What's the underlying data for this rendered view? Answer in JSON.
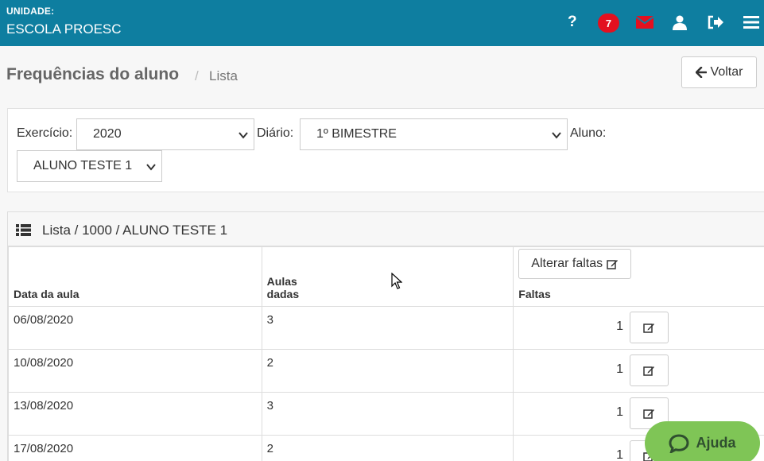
{
  "header": {
    "unit_label": "UNIDADE:",
    "unit_name": "ESCOLA PROESC",
    "notification_count": "7",
    "help_glyph": "?"
  },
  "page": {
    "title": "Frequências do aluno",
    "separator": "/",
    "breadcrumb": "Lista",
    "back_label": "Voltar"
  },
  "filters": {
    "exercicio_label": "Exercício:",
    "exercicio_value": "2020",
    "diario_label": "Diário:",
    "diario_value": "1º BIMESTRE",
    "aluno_label": "Aluno:",
    "aluno_value": "ALUNO TESTE 1"
  },
  "list": {
    "title": "Lista / 1000 / ALUNO TESTE 1",
    "columns": {
      "data": "Data da aula",
      "aulas_line1": "Aulas",
      "aulas_line2": "dadas",
      "faltas": "Faltas",
      "alter_label": "Alterar faltas"
    },
    "rows": [
      {
        "date": "06/08/2020",
        "aulas": "3",
        "faltas": "1"
      },
      {
        "date": "10/08/2020",
        "aulas": "2",
        "faltas": "1"
      },
      {
        "date": "13/08/2020",
        "aulas": "3",
        "faltas": "1"
      },
      {
        "date": "17/08/2020",
        "aulas": "2",
        "faltas": "1"
      }
    ]
  },
  "help_button": {
    "label": "Ajuda"
  },
  "colors": {
    "header_bg": "#0e7ea0",
    "badge_bg": "#e3101f",
    "help_bg": "#7fc556"
  },
  "icons": [
    "help-icon",
    "envelope-icon",
    "user-icon",
    "logout-icon",
    "menu-icon",
    "arrow-left-icon",
    "list-icon",
    "edit-icon",
    "chevron-down-icon",
    "chat-icon"
  ]
}
